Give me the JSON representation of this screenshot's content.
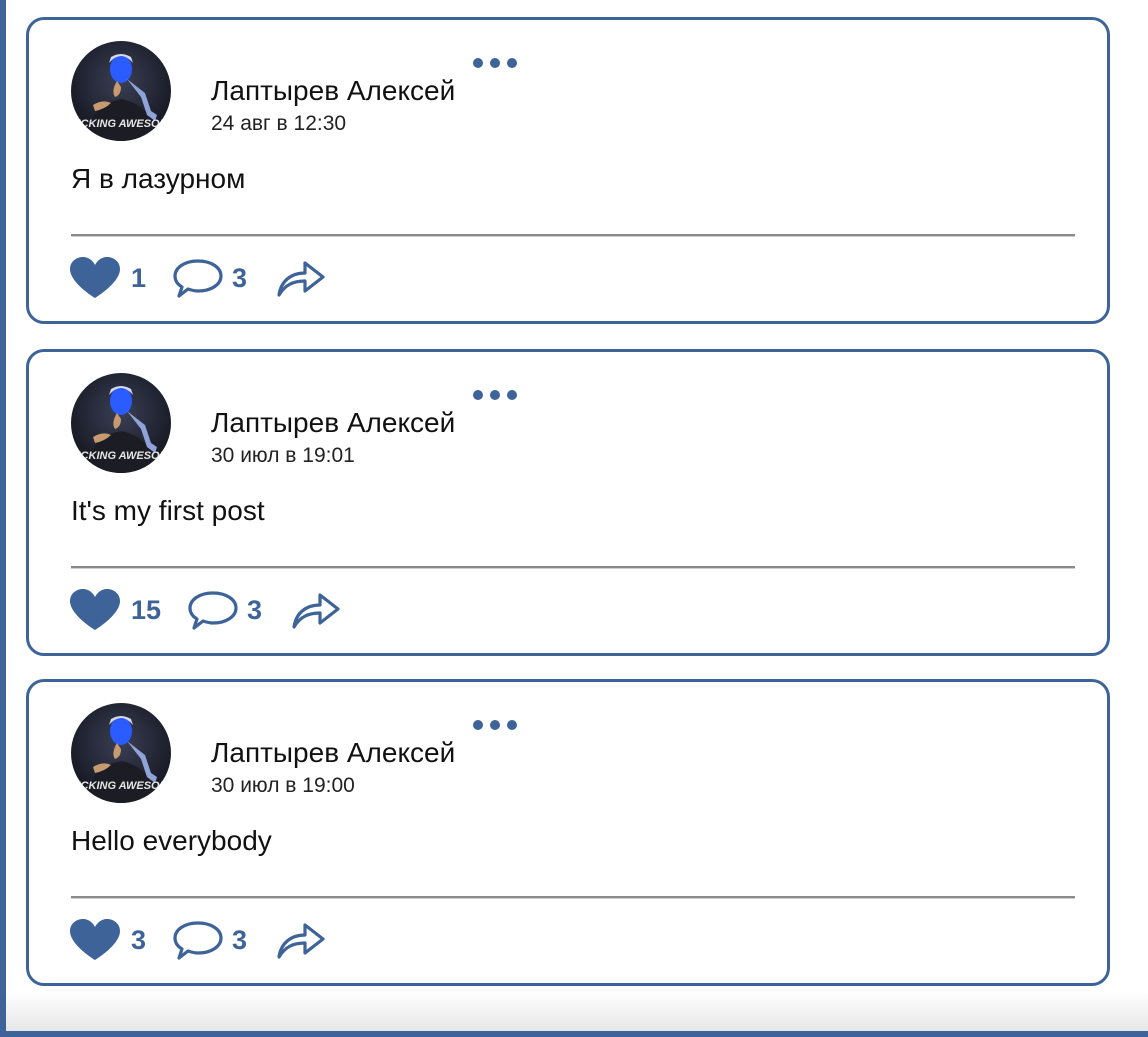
{
  "colors": {
    "accent": "#3d6399",
    "divider": "#8a8a8a"
  },
  "posts": [
    {
      "author": "Лаптырев Алексей",
      "date": "24 авг в 12:30",
      "text": "Я в лазурном",
      "likes": "1",
      "comments": "3",
      "avatar_caption": "FUCKING AWESOME"
    },
    {
      "author": "Лаптырев Алексей",
      "date": "30 июл в 19:01",
      "text": "It's my first post",
      "likes": "15",
      "comments": "3",
      "avatar_caption": "FUCKING AWESOME"
    },
    {
      "author": "Лаптырев Алексей",
      "date": "30 июл в 19:00",
      "text": "Hello everybody",
      "likes": "3",
      "comments": "3",
      "avatar_caption": "FUCKING AWESOME"
    }
  ],
  "icons": {
    "menu": "more-dots-icon",
    "like": "heart-icon",
    "comment": "speech-bubble-icon",
    "share": "share-arrow-icon"
  }
}
